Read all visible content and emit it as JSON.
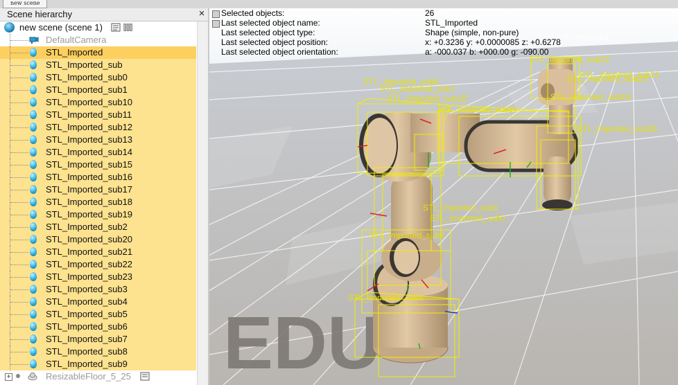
{
  "window": {
    "tab_label": "new scene"
  },
  "hierarchy": {
    "title": "Scene hierarchy",
    "close_glyph": "×",
    "root_label": "new scene (scene 1)",
    "camera_label": "DefaultCamera",
    "items": [
      "STL_Imported",
      "STL_Imported_sub",
      "STL_Imported_sub0",
      "STL_Imported_sub1",
      "STL_Imported_sub10",
      "STL_Imported_sub11",
      "STL_Imported_sub12",
      "STL_Imported_sub13",
      "STL_Imported_sub14",
      "STL_Imported_sub15",
      "STL_Imported_sub16",
      "STL_Imported_sub17",
      "STL_Imported_sub18",
      "STL_Imported_sub19",
      "STL_Imported_sub2",
      "STL_Imported_sub20",
      "STL_Imported_sub21",
      "STL_Imported_sub22",
      "STL_Imported_sub23",
      "STL_Imported_sub3",
      "STL_Imported_sub4",
      "STL_Imported_sub5",
      "STL_Imported_sub6",
      "STL_Imported_sub7",
      "STL_Imported_sub8",
      "STL_Imported_sub9"
    ],
    "floor_label": "ResizableFloor_5_25",
    "icons": {
      "root": "globe-icon",
      "object": "shape-icon",
      "camera": "camera-icon",
      "floor": "floor-icon",
      "script": "script-icon"
    },
    "colors": {
      "selected_row": "#fde28f",
      "current_row": "#fccf5f"
    }
  },
  "info": {
    "rows": [
      {
        "label": "Selected objects:",
        "value": "26"
      },
      {
        "label": "Last selected object name:",
        "value": "STL_Imported"
      },
      {
        "label": "Last selected object type:",
        "value": "Shape (simple, non-pure)"
      },
      {
        "label": "Last selected object position:",
        "value": "x: +0.3236    y: +0.0000085    z: +0.6278"
      },
      {
        "label": "Last selected object orientation:",
        "value": "a: -000.037    b: +000.00    g: -090.00"
      }
    ]
  },
  "viewport": {
    "watermark": "EDU",
    "labels": [
      "STL_Imported",
      "STL_Imported_sub22",
      "STL_Imported_sub21",
      "STL_Imported_sub23",
      "STL_Imported_sub19",
      "STL_Imported_sub20",
      "STL_Imported_sub8",
      "STL_Imported_sub7",
      "STL_Imported_sub10",
      "STL_Imported_sub11",
      "STL_Imported_sub1",
      "STL_Imported_sub0",
      "STL_Imported_sub6",
      "STL_Imported_sub4"
    ],
    "colors": {
      "bounding_box": "#f2ee00",
      "robot_body": "#d7bc98",
      "robot_dark": "#3b3834",
      "floor_light": "#ccc8c4",
      "floor_dark": "#a8a39e",
      "sky_top": "#ffffff"
    }
  }
}
